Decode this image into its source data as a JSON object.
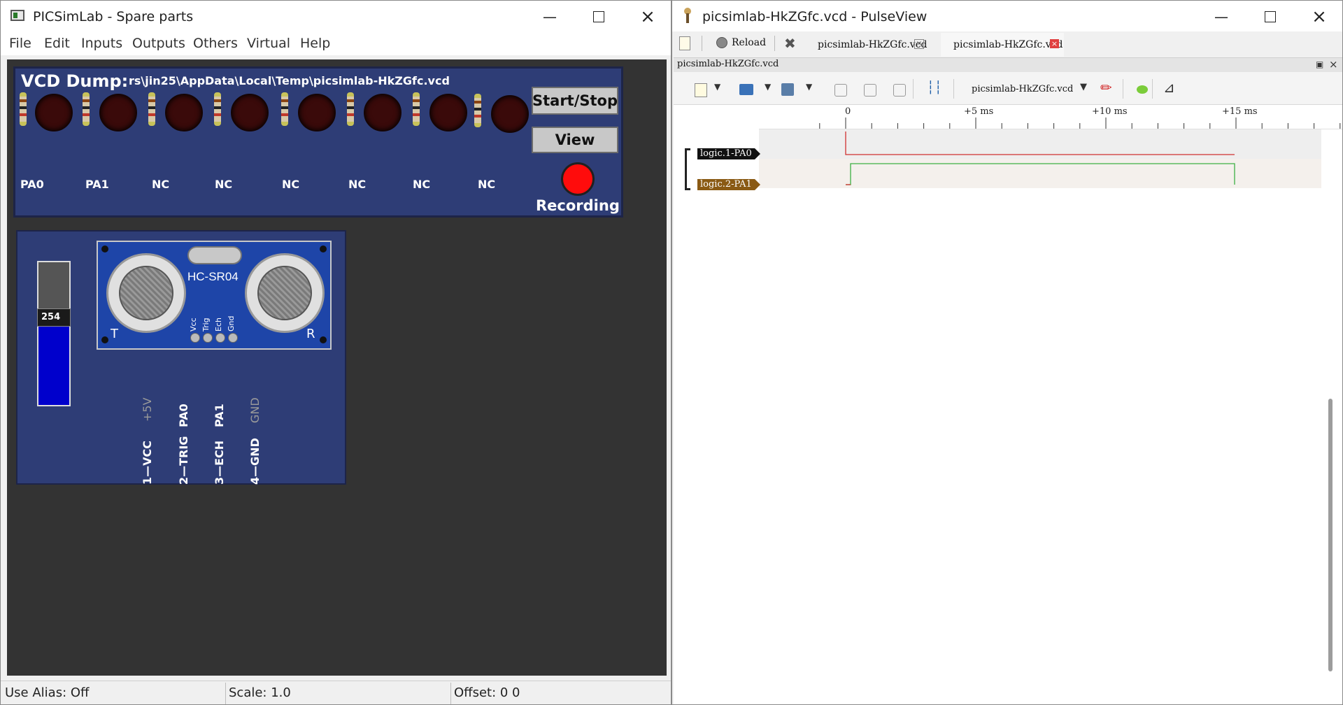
{
  "left_window": {
    "title": "PICSimLab - Spare parts",
    "menu": [
      "File",
      "Edit",
      "Inputs",
      "Outputs",
      "Others",
      "Virtual",
      "Help"
    ],
    "vcd_board": {
      "title": "VCD Dump:",
      "path": "rs\\jin25\\AppData\\Local\\Temp\\picsimlab-HkZGfc.vcd",
      "pins": [
        "PA0",
        "PA1",
        "NC",
        "NC",
        "NC",
        "NC",
        "NC",
        "NC"
      ],
      "start_stop_label": "Start/Stop",
      "view_label": "View",
      "recording_label": "Recording",
      "recording_color": "#ff0000"
    },
    "sensor_board": {
      "slider_value": "254",
      "module_name": "HC-SR04",
      "pin_header": [
        "Vcc",
        "Trig",
        "Ech",
        "Gnd"
      ],
      "corner_left": "T",
      "corner_right": "R",
      "connections": [
        {
          "pin": "1—VCC",
          "signal": "+5V"
        },
        {
          "pin": "2—TRIG",
          "signal": "PA0"
        },
        {
          "pin": "3—ECH",
          "signal": "PA1"
        },
        {
          "pin": "4—GND",
          "signal": "GND"
        }
      ]
    },
    "status": {
      "alias": "Use Alias: Off",
      "scale": "Scale: 1.0",
      "offset": "Offset:  0  0"
    }
  },
  "right_window": {
    "title": "picsimlab-HkZGfc.vcd - PulseView",
    "reload_label": "Reload",
    "tabs": [
      "picsimlab-HkZGfc.vcd",
      "picsimlab-HkZGfc.vcd"
    ],
    "dock_title": "picsimlab-HkZGfc.vcd",
    "device_select": "picsimlab-HkZGfc.vcd",
    "ruler_labels": [
      "0",
      "+5 ms",
      "+10 ms",
      "+15 ms"
    ],
    "signals": [
      {
        "name": "logic.1-PA0",
        "color": "#d03030",
        "label_bg": "#111111"
      },
      {
        "name": "logic.2-PA1",
        "color": "#3cb043",
        "label_bg": "#8a5a14"
      }
    ]
  }
}
